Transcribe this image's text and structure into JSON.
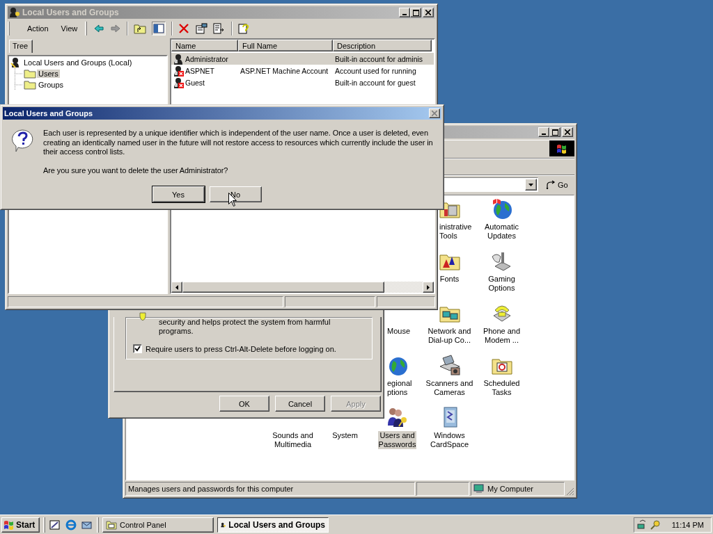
{
  "control_panel": {
    "address": {
      "go": "Go"
    },
    "icons": [
      {
        "lines": [
          "inistrative",
          "Tools"
        ],
        "selected": false
      },
      {
        "lines": [
          "Automatic",
          "Updates"
        ],
        "selected": false
      },
      {
        "lines": [
          "Fonts"
        ],
        "selected": false
      },
      {
        "lines": [
          "Gaming",
          "Options"
        ],
        "selected": false
      },
      {
        "lines": [
          "Mouse"
        ],
        "selected": false
      },
      {
        "lines": [
          "Network and",
          "Dial-up Co..."
        ],
        "selected": false
      },
      {
        "lines": [
          "Phone and",
          "Modem ..."
        ],
        "selected": false
      },
      {
        "lines": [
          "egional",
          "ptions"
        ],
        "selected": false
      },
      {
        "lines": [
          "Scanners and",
          "Cameras"
        ],
        "selected": false
      },
      {
        "lines": [
          "Scheduled",
          "Tasks"
        ],
        "selected": false
      },
      {
        "lines": [
          "Sounds and",
          "Multimedia"
        ],
        "selected": false
      },
      {
        "lines": [
          "System"
        ],
        "selected": false
      },
      {
        "lines": [
          "Users and",
          "Passwords"
        ],
        "selected": true
      },
      {
        "lines": [
          "Windows",
          "CardSpace"
        ],
        "selected": false
      }
    ],
    "status_bar": {
      "text": "Manages users and passwords for this computer",
      "zone": "My Computer"
    }
  },
  "security_dialog": {
    "text": "security and helps protect the system from harmful programs.",
    "checkbox": {
      "label": "Require users to press Ctrl-Alt-Delete before logging on.",
      "checked": true
    },
    "buttons": [
      {
        "label": "OK",
        "disabled": false
      },
      {
        "label": "Cancel",
        "disabled": false
      },
      {
        "label": "Apply",
        "disabled": true
      }
    ]
  },
  "lug_window": {
    "title": "Local Users and Groups",
    "active": false,
    "menu": [
      "Action",
      "View"
    ],
    "tab": "Tree",
    "tree": {
      "label": "Local Users and Groups (Local)",
      "children": [
        {
          "label": "Users",
          "selected": true
        },
        {
          "label": "Groups",
          "selected": false
        }
      ]
    },
    "columns": [
      "Name",
      "Full Name",
      "Description"
    ],
    "rows": [
      {
        "name": "Administrator",
        "description": "Built-in account for adminis",
        "disabled": false,
        "selected": true
      },
      {
        "name": "ASPNET",
        "full_name": "ASP.NET Machine Account",
        "description": "Account used for running",
        "disabled": true,
        "selected": false
      },
      {
        "name": "Guest",
        "description": "Built-in account for guest",
        "disabled": true,
        "selected": false
      }
    ]
  },
  "dialog": {
    "title": "Local Users and Groups",
    "active": true,
    "message": "Each user is represented by a unique identifier which is independent of the user name.  Once a user is deleted, even creating an identically named user in the future will not restore access to resources which currently include the user in their access control lists.",
    "question": "Are you sure you want to delete the user Administrator?",
    "buttons": [
      {
        "label": "Yes",
        "default": true
      },
      {
        "label": "No",
        "default": false
      }
    ]
  },
  "taskbar": {
    "start": "Start",
    "tasks": [
      {
        "label": "Control Panel",
        "selected": false
      },
      {
        "label": "Local Users and Groups",
        "selected": true
      }
    ],
    "clock": "11:14 PM"
  }
}
